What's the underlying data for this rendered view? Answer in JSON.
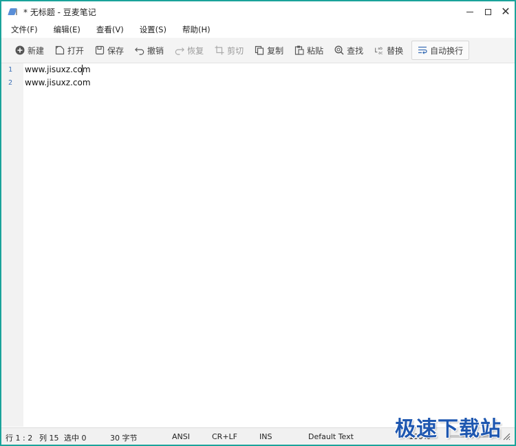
{
  "window": {
    "title": "* 无标题 - 豆麦笔记",
    "accent": "#1aa39a"
  },
  "menu": [
    "文件(F)",
    "编辑(E)",
    "查看(V)",
    "设置(S)",
    "帮助(H)"
  ],
  "toolbar": {
    "new": "新建",
    "open": "打开",
    "save": "保存",
    "undo": "撤销",
    "redo": "恢复",
    "cut": "剪切",
    "copy": "复制",
    "paste": "粘贴",
    "find": "查找",
    "replace": "替换",
    "autowrap": "自动换行"
  },
  "editor": {
    "lines": [
      {
        "num": "1",
        "text": "www.jisuxz.com"
      },
      {
        "num": "2",
        "text": "www.jisuxz.com"
      }
    ]
  },
  "status": {
    "row": "行 1 : 2",
    "col": "列 15",
    "selected": "选中 0",
    "bytes": "30 字节",
    "encoding": "ANSI",
    "eol": "CR+LF",
    "mode": "INS",
    "syntax": "Default Text",
    "zoom": "100%"
  },
  "watermark": "极速下载站"
}
